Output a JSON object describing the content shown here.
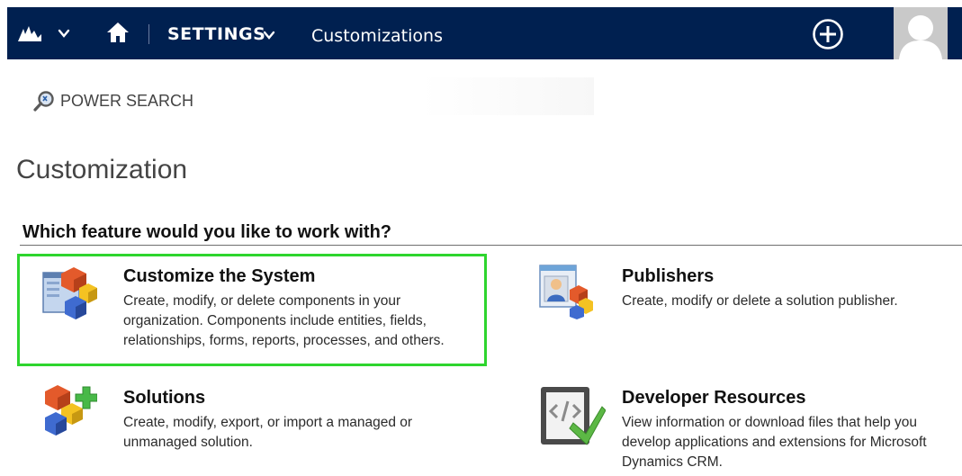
{
  "nav": {
    "logo_icon": "dynamics-logo-icon",
    "home_icon": "home-icon",
    "area_label": "SETTINGS",
    "breadcrumb": "Customizations",
    "create_icon": "plus-circle-icon",
    "avatar_icon": "user-avatar",
    "colors": {
      "bar": "#002050",
      "text": "#ffffff"
    }
  },
  "commandbar": {
    "power_search_label": "POWER SEARCH",
    "power_search_icon": "power-search-icon"
  },
  "page": {
    "title": "Customization",
    "section_heading": "Which feature would you like to work with?"
  },
  "features": {
    "customize": {
      "title": "Customize the System",
      "description": "Create, modify, or delete components in your organization. Components include entities, fields, relationships, forms, reports, processes, and others.",
      "icon": "customize-system-icon",
      "highlighted": true,
      "highlight_color": "#2ed52e"
    },
    "publishers": {
      "title": "Publishers",
      "description": "Create, modify or delete a solution publisher.",
      "icon": "publishers-icon"
    },
    "solutions": {
      "title": "Solutions",
      "description": "Create, modify, export, or import a managed or unmanaged solution.",
      "icon": "solutions-icon"
    },
    "developer_resources": {
      "title": "Developer Resources",
      "description": "View information or download files that help you develop applications and extensions for Microsoft Dynamics CRM.",
      "icon": "developer-resources-icon"
    }
  }
}
